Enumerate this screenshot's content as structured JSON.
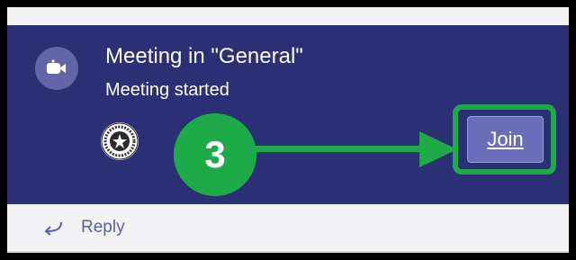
{
  "meeting_card": {
    "icon": "video-camera-icon",
    "title": "Meeting in \"General\"",
    "status": "Meeting started",
    "participant_avatar": "state-seal-avatar",
    "join_label": "Join"
  },
  "annotation": {
    "step_number": "3",
    "highlight_color": "#1faa4a"
  },
  "reply": {
    "icon": "reply-arrow-icon",
    "label": "Reply"
  },
  "colors": {
    "card_background": "#2b2f73",
    "join_button": "#6a6dba",
    "icon_circle": "#6265a8",
    "reply_text": "#5b5fa8"
  }
}
